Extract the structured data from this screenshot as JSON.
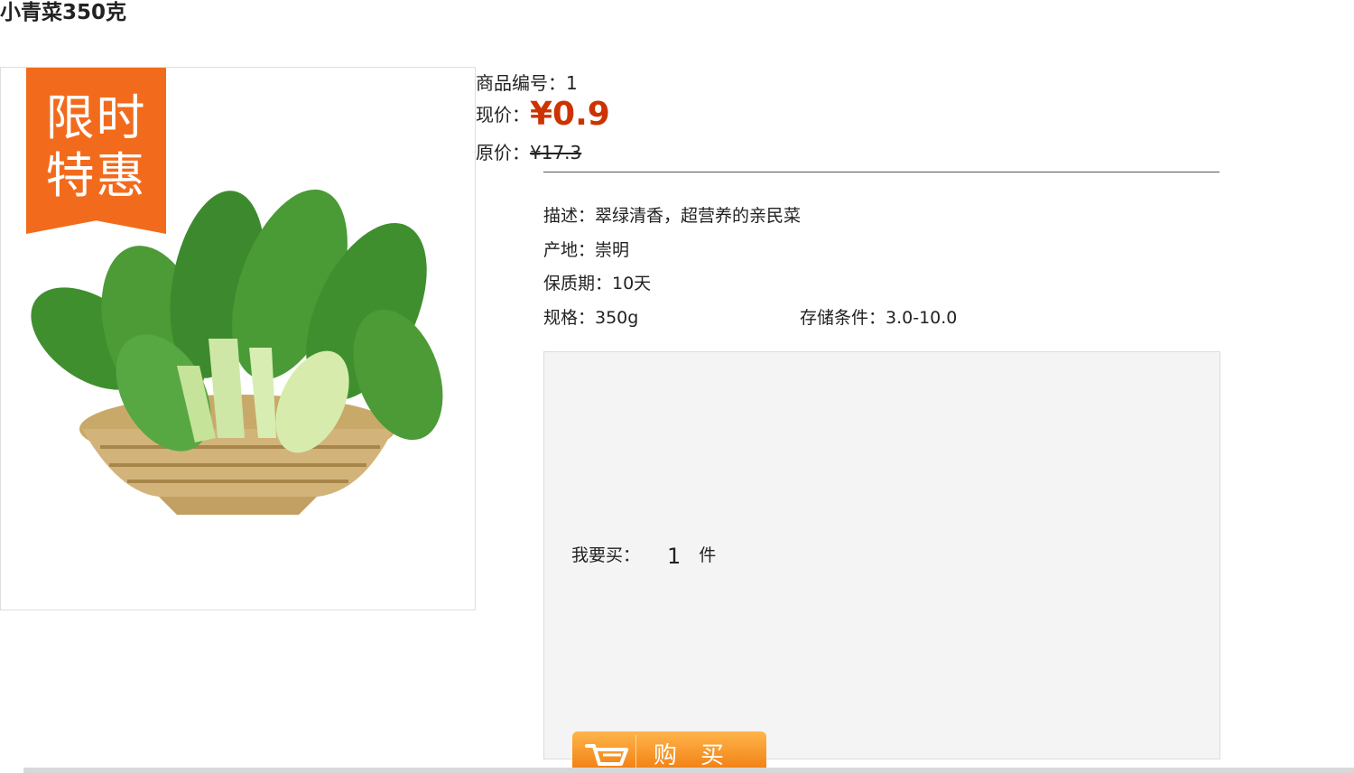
{
  "product": {
    "title": "小青菜350克",
    "promo_badge": "限时特惠",
    "code_label": "商品编号：",
    "code": "1",
    "price_label": "现价：",
    "price": "¥0.9",
    "original_price_label": "原价：",
    "original_price": "¥17.3"
  },
  "details": {
    "description": "描述：翠绿清香，超营养的亲民菜",
    "origin": "产地：崇明",
    "shelf_life": "保质期：10天",
    "spec": "规格：350g",
    "storage": "存储条件：3.0-10.0"
  },
  "purchase": {
    "quantity_label": "我要买：",
    "quantity": "1",
    "unit": "件",
    "buy_button_label": "购买"
  },
  "colors": {
    "price": "#cc3300",
    "promo": "#f26b1d",
    "button": "#f07c10"
  }
}
